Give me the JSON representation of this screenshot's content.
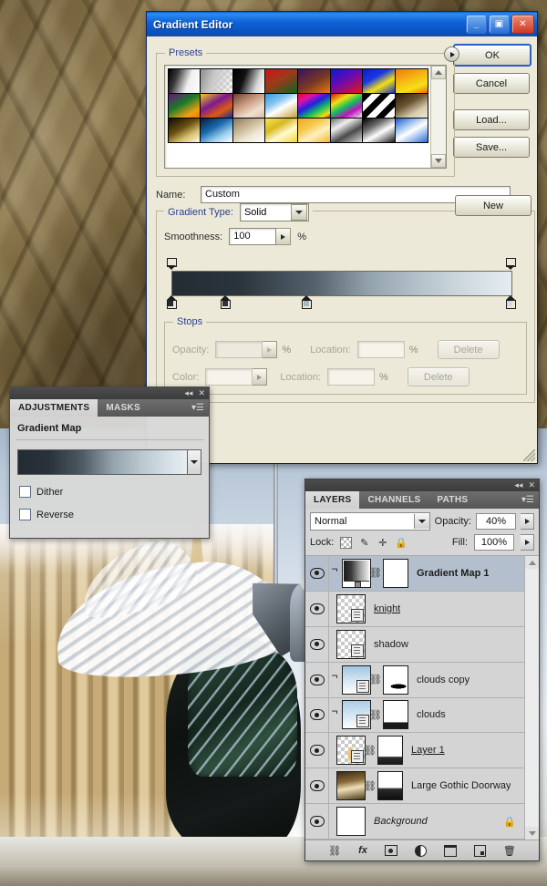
{
  "gradient_editor": {
    "title": "Gradient Editor",
    "window_buttons": {
      "minimize": "minimize-icon",
      "maximize": "maximize-icon",
      "close": "close-icon"
    },
    "presets": {
      "label": "Presets",
      "menu_icon": "preset-menu-arrow-icon",
      "swatches": [
        "linear-gradient(110deg,#000 0%,#3a3a3a 26%,#efefef 62%,#ffffff 100%)",
        "linear-gradient(110deg,#8d8d8d 0%,#c9c9c9 40%,rgba(255,255,255,0.15) 100%)",
        "linear-gradient(110deg,#000 0%,#111 34%,#d8d8d8 74%,#ffffff 100%)",
        "linear-gradient(150deg,#cf1414 0%,#9a3b1c 45%,#13611f 100%)",
        "linear-gradient(150deg,#3a1060 0%,#7a3a22 55%,#f07a0a 100%)",
        "linear-gradient(150deg,#0a1ad6 0%,#6a0ab0 45%,#ea1414 100%)",
        "linear-gradient(150deg,#0a1ad6 0%,#1a3ae0 36%,#f5e016 64%,#1030c8 100%)",
        "linear-gradient(160deg,#f07a0a 0%,#f5c116 48%,#f5e016 72%,#f06a0a 100%)",
        "linear-gradient(150deg,#6a1080 0%,#1a7a2a 42%,#f0a010 78%,#f07a0a 100%)",
        "linear-gradient(150deg,#f5d016 0%,#7a1a90 40%,#e05a10 70%,#1030a0 100%)",
        "linear-gradient(150deg,#6a4030 0%,#c99a80 40%,#f0e0d0 72%,#d8c0a8 100%)",
        "linear-gradient(150deg,#2a9ae0 0%,#8ac6ee 34%,#ffffff 56%,#c0a030 100%)",
        "linear-gradient(150deg,#e01010 0%,#e010b0 22%,#2020e0 44%,#10c060 66%,#f0e010 88%,#e01010 100%)",
        "linear-gradient(150deg,#e01010 0%,#f0e010 28%,#10c060 50%,#c010c0 72%,rgba(255,255,255,0.2) 100%)",
        "repeating-linear-gradient(135deg,#000 0px,#000 7px,#fff 7px,#fff 14px)",
        "linear-gradient(150deg,#2a1c0c 0%,#6a5430 40%,#d8cbb0 72%,#efe8d8 100%)",
        "linear-gradient(150deg,#0e0a02 0%,#6a5010 42%,#d8c070 70%,#fffbe8 100%)",
        "linear-gradient(150deg,#0a1a3a 0%,#1a6ab0 40%,#9ad0ee 70%,#ffffff 100%)",
        "linear-gradient(150deg,#8a7a60 0%,#c9b898 38%,#efe6d4 66%,#ffffff 100%)",
        "linear-gradient(150deg,#f5e84a 0%,#d8b820 34%,#fffbd0 62%,#f0d830 100%)",
        "linear-gradient(150deg,#f0a820 0%,#f5c84a 34%,#fff0c0 62%,#f0b830 100%)",
        "linear-gradient(150deg,#6a6a6a 0%,#efefef 30%,#4a4a4a 62%,#d8d8d8 100%)",
        "linear-gradient(150deg,#000 0%,#6a6a6a 32%,#ffffff 58%,#1a1a1a 100%)",
        "linear-gradient(150deg,#1a5ad0 0%,#9ac0ee 30%,#ffffff 52%,#2a6ad8 100%)"
      ],
      "scroll_up": "scroll-up-icon",
      "scroll_down": "scroll-down-icon"
    },
    "name_label": "Name:",
    "name_value": "Custom",
    "new_button": "New",
    "gradient_type_label": "Gradient Type:",
    "gradient_type_value": "Solid",
    "smoothness_label": "Smoothness:",
    "smoothness_value": "100",
    "smoothness_unit": "%",
    "gradient_preview_css": "linear-gradient(90deg,#232c33 0%,#2a343c 20%,#55626c 42%,#93a3ad 58%,#b7c4cc 74%,#d2dce2 88%,#e6edf1 100%)",
    "opacity_stops": [
      {
        "position_pct": 0
      },
      {
        "position_pct": 100
      }
    ],
    "color_stops": [
      {
        "position_pct": 0,
        "color": "#232c33"
      },
      {
        "position_pct": 16,
        "color": "#2b343c"
      },
      {
        "position_pct": 40,
        "color": "#a8b6c0"
      },
      {
        "position_pct": 100,
        "color": "#cfdae1"
      }
    ],
    "stops": {
      "label": "Stops",
      "opacity_label": "Opacity:",
      "opacity_value": "",
      "opacity_unit": "%",
      "opacity_location_label": "Location:",
      "opacity_location_value": "",
      "opacity_location_unit": "%",
      "opacity_delete": "Delete",
      "color_label": "Color:",
      "color_location_label": "Location:",
      "color_location_value": "",
      "color_location_unit": "%",
      "color_delete": "Delete"
    },
    "buttons": {
      "ok": "OK",
      "cancel": "Cancel",
      "load": "Load...",
      "save": "Save..."
    }
  },
  "adjustments_panel": {
    "collapse_icon": "collapse-icon",
    "close_icon": "close-icon",
    "tabs": [
      {
        "label": "ADJUSTMENTS",
        "active": true
      },
      {
        "label": "MASKS",
        "active": false
      }
    ],
    "menu_icon": "panel-menu-icon",
    "title": "Gradient Map",
    "gradient_preview_css": "linear-gradient(90deg,#232c33 0%,#29323a 18%,#4e5a64 38%,#93a3ad 56%,#bcc9d1 74%,#d7e1e7 90%,#e8eef2 100%)",
    "dropdown_icon": "gradient-dropdown-icon",
    "checkboxes": [
      {
        "label": "Dither",
        "checked": false
      },
      {
        "label": "Reverse",
        "checked": false
      }
    ]
  },
  "layers_panel": {
    "collapse_icon": "collapse-icon",
    "close_icon": "close-icon",
    "tabs": [
      {
        "label": "LAYERS",
        "active": true
      },
      {
        "label": "CHANNELS",
        "active": false
      },
      {
        "label": "PATHS",
        "active": false
      }
    ],
    "menu_icon": "panel-menu-icon",
    "blend_mode": "Normal",
    "opacity_label": "Opacity:",
    "opacity_value": "40%",
    "lock_label": "Lock:",
    "lock_icons": [
      "lock-transparency-icon",
      "lock-image-icon",
      "lock-position-icon",
      "lock-all-icon"
    ],
    "fill_label": "Fill:",
    "fill_value": "100%",
    "layers": [
      {
        "name": "Gradient Map 1",
        "visible": true,
        "selected": true,
        "clipped": true,
        "style": "bold",
        "thumb_type": "gradient-map",
        "thumb_css": "linear-gradient(90deg,#1b1b1b 0%,#3a3a3a 30%,#9a9a9a 62%,#f2f2f2 100%)",
        "has_link": true,
        "has_mask": true,
        "mask_css": "#ffffff",
        "locked": false
      },
      {
        "name": "knight",
        "visible": true,
        "selected": false,
        "clipped": false,
        "style": "underline",
        "thumb_type": "checker",
        "thumb_css": "",
        "has_link": false,
        "has_mask": false,
        "mask_css": "",
        "locked": false
      },
      {
        "name": "shadow",
        "visible": true,
        "selected": false,
        "clipped": false,
        "style": "normal",
        "thumb_type": "checker",
        "thumb_css": "",
        "has_link": false,
        "has_mask": false,
        "mask_css": "",
        "locked": false
      },
      {
        "name": "clouds copy",
        "visible": true,
        "selected": false,
        "clipped": true,
        "style": "normal",
        "thumb_type": "checker-image",
        "thumb_css": "linear-gradient(180deg,#9ec4e4 0%,#d8e8f4 55%,#ffffff 100%)",
        "has_link": true,
        "has_mask": true,
        "mask_css": "radial-gradient(ellipse 14px 4px at 16px 22px,#000 0 60%,#fff 62%)",
        "locked": false
      },
      {
        "name": "clouds",
        "visible": true,
        "selected": false,
        "clipped": true,
        "style": "normal",
        "thumb_type": "checker-image",
        "thumb_css": "linear-gradient(180deg,#a8cce8 0%,#dceaf6 60%,#ffffff 100%)",
        "has_link": true,
        "has_mask": true,
        "mask_css": "linear-gradient(180deg,#fff 0 76%,#1a1a1a 80%,#1a1a1a 100%)",
        "locked": false
      },
      {
        "name": "Layer 1",
        "visible": true,
        "selected": false,
        "clipped": false,
        "style": "underline",
        "thumb_type": "checker-image",
        "thumb_css": "radial-gradient(ellipse 6px 14px at 15px 20px,#e8c070 0 40%,rgba(255,255,255,0) 72%)",
        "has_link": true,
        "has_mask": true,
        "mask_css": "linear-gradient(180deg,#fff 0 72%,#2a2a2a 76%,#1a1a1a 100%)",
        "locked": false
      },
      {
        "name": "Large Gothic Doorway",
        "visible": true,
        "selected": false,
        "clipped": false,
        "style": "normal",
        "thumb_type": "image",
        "thumb_css": "linear-gradient(170deg,#3a2a12 0%,#8a6a3a 35%,#efe0b8 58%,#4a3a1a 100%)",
        "has_link": true,
        "has_mask": true,
        "mask_css": "linear-gradient(180deg,#fff 0 56%,#2a2a2a 62%,#0f0f0f 100%)",
        "locked": false
      },
      {
        "name": "Background",
        "visible": true,
        "selected": false,
        "clipped": false,
        "style": "italic",
        "thumb_type": "white",
        "thumb_css": "#ffffff",
        "has_link": false,
        "has_mask": false,
        "mask_css": "",
        "locked": true
      }
    ],
    "bottom_icons": [
      "link-layers-icon",
      "layer-style-fx-icon",
      "add-layer-mask-icon",
      "new-adjustment-layer-icon",
      "new-group-icon",
      "new-layer-icon",
      "delete-layer-icon"
    ]
  }
}
